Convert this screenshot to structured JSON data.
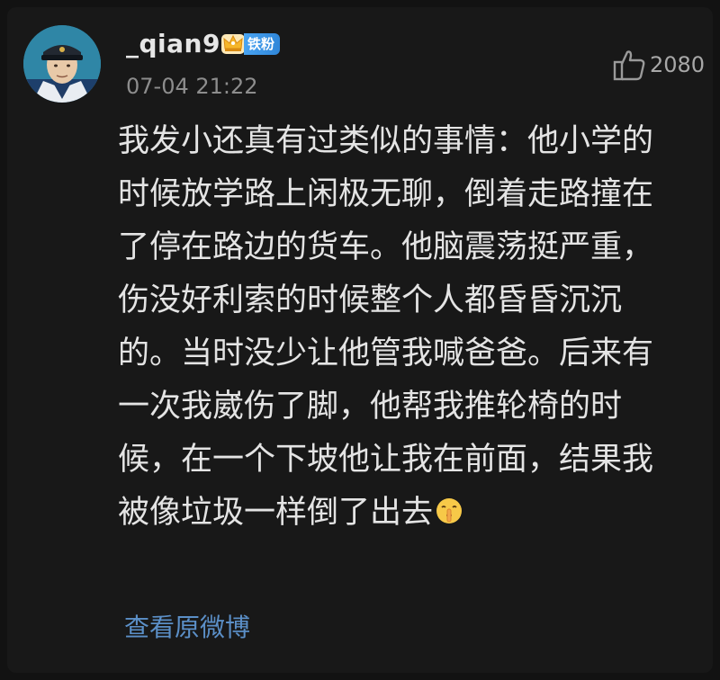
{
  "post": {
    "username": "_qian9",
    "fan_badge": "铁粉",
    "timestamp": "07-04 21:22",
    "like_count": "2080",
    "lines": [
      "我发小还真有过类似的事情：他小学的",
      "时候放学路上闲极无聊，倒着走路撞在",
      "了停在路边的货车。他脑震荡挺严重，",
      "伤没好利索的时候整个人都昏昏沉沉",
      "的。当时没少让他管我喊爸爸。后来有",
      "一次我崴伤了脚，他帮我推轮椅的时",
      "候，在一个下坡他让我在前面，结果我",
      "被像垃圾一样倒了出去"
    ],
    "end_emoji": "shushing-face-emoji",
    "view_original_label": "查看原微博"
  },
  "icons": {
    "crown": "crown-icon",
    "thumb": "thumbs-up-icon"
  },
  "colors": {
    "background": "#121212",
    "card": "#181818",
    "text": "#e4e4e4",
    "muted": "#8d8d8d",
    "link": "#5b8fc7",
    "badge": "#3a93e6",
    "crown": "#f5b62a"
  }
}
